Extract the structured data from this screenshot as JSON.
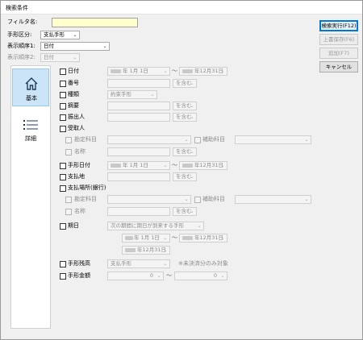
{
  "window": {
    "title": "検索条件"
  },
  "filter": {
    "label": "フィルタ名:",
    "value": ""
  },
  "form_type": {
    "label": "手形区分:",
    "value": "支払手形"
  },
  "sort1": {
    "label": "表示順序1:",
    "value": "日付"
  },
  "sort2": {
    "label": "表示順序2:",
    "value": "日付"
  },
  "buttons": {
    "search": "検索実行(F12)",
    "overwrite": "上書保存(F6)",
    "add": "追加(F7)",
    "cancel": "キャンセル"
  },
  "nav": {
    "basic": "基本",
    "detail": "詳細"
  },
  "fields": {
    "date": "日付",
    "number": "番号",
    "kind": "種類",
    "summary": "摘要",
    "inout": "振出人",
    "receiver": "受取人",
    "account": "勘定科目",
    "sub_account": "補助科目",
    "name": "名称",
    "form_date": "手形日付",
    "pay_place": "支払地",
    "pay_bank": "支払場所(銀行)",
    "due": "期日",
    "status": "手形残高",
    "amount": "手形金額"
  },
  "values": {
    "date_from": "年  1月  1日",
    "date_to": "年12月31日",
    "contains": "を含む",
    "kind_value": "約束手形",
    "form_date_from": "年  1月  1日",
    "form_date_to": "年12月31日",
    "due_mode": "次の期間に期日が到来する手形",
    "due_from": "年  1月  1日",
    "due_to": "年12月31日",
    "due_end": "年12月31日",
    "status_value": "支払手形",
    "status_note": "※未決済分のみ対象",
    "amount_from": "0",
    "amount_to": "0",
    "tilde": "〜"
  },
  "colors": {
    "accent": "#0078d7",
    "highlight": "#ffffcc",
    "nav_active": "#cce4f7"
  }
}
